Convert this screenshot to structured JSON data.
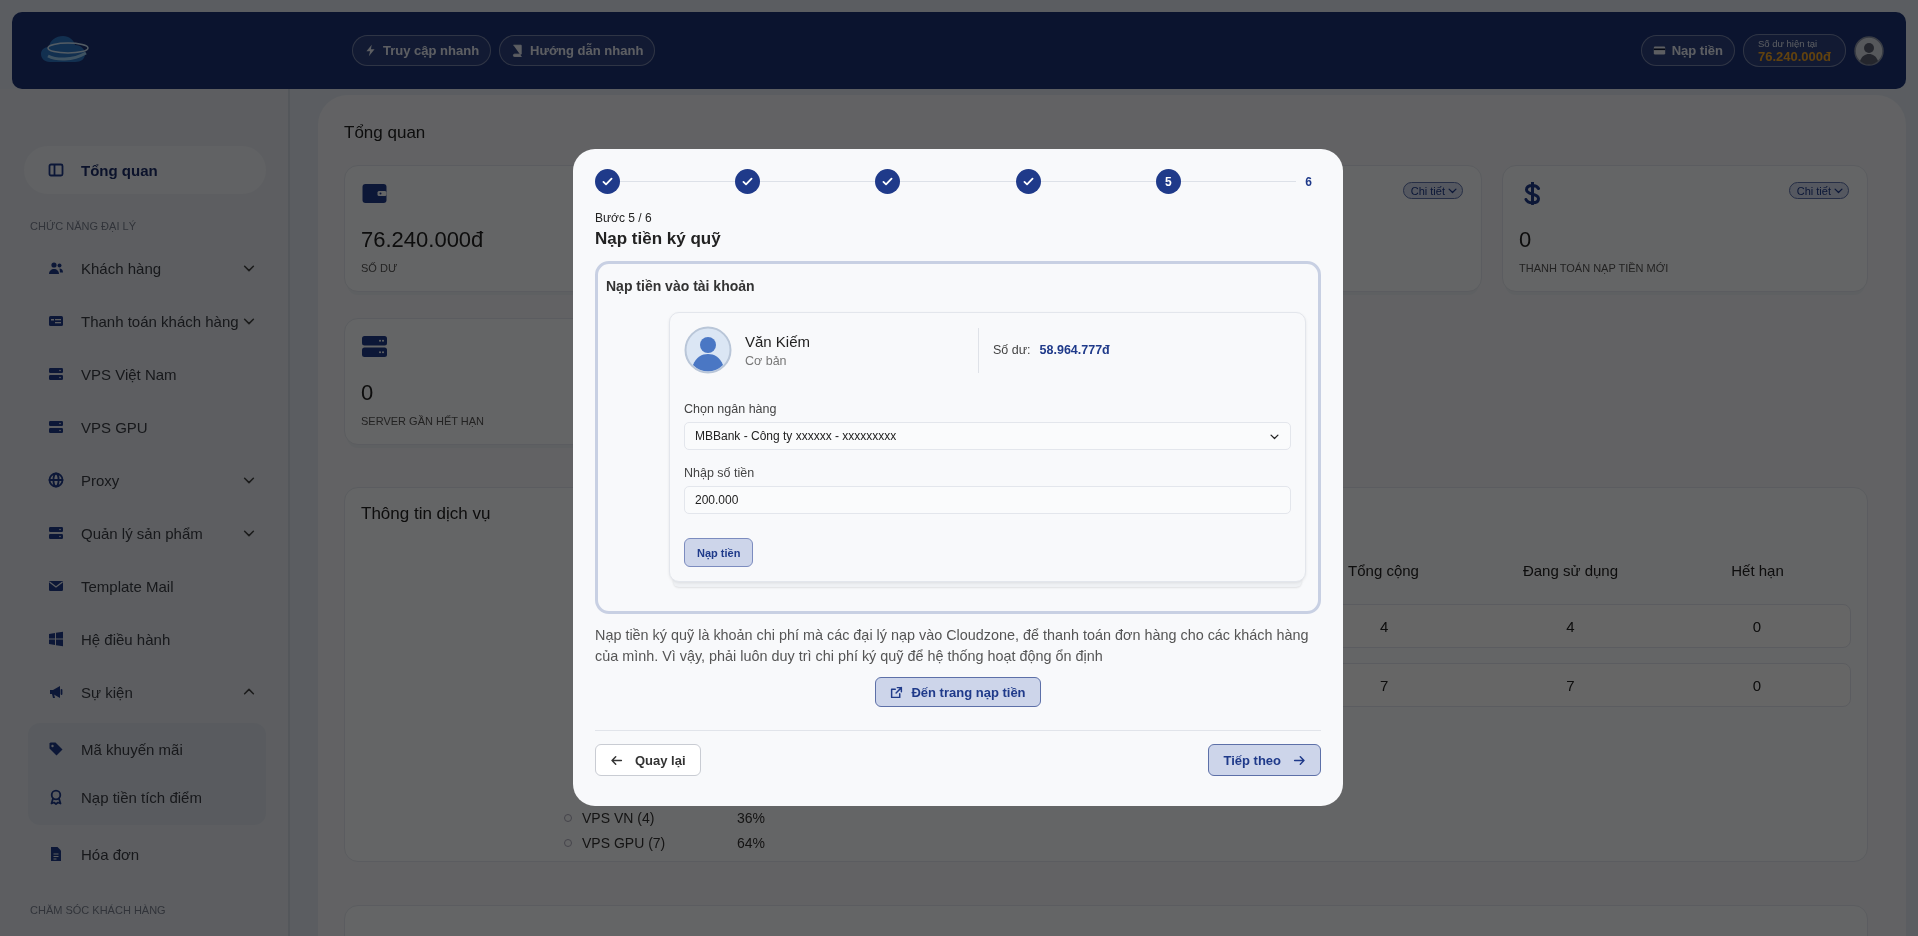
{
  "header": {
    "quick_buttons": [
      "Truy cập nhanh",
      "Hướng dẫn nhanh"
    ],
    "topup_button": "Nạp tiền",
    "balance": {
      "label": "Số dư hiện tại",
      "value": "76.240.000đ"
    }
  },
  "sidebar": {
    "items": [
      {
        "kind": "item",
        "label": "Tổng quan",
        "selected": true
      },
      {
        "kind": "section",
        "label": "CHỨC NĂNG ĐẠI LÝ"
      },
      {
        "kind": "item",
        "label": "Khách hàng",
        "selected": false,
        "expanded": false
      },
      {
        "kind": "item",
        "label": "Thanh toán khách hàng",
        "selected": false,
        "expanded": false
      },
      {
        "kind": "item",
        "label": "VPS Việt Nam",
        "selected": false
      },
      {
        "kind": "item",
        "label": "VPS GPU",
        "selected": false
      },
      {
        "kind": "item",
        "label": "Proxy",
        "selected": false,
        "expanded": false
      },
      {
        "kind": "item",
        "label": "Quản lý sản phẩm",
        "selected": false,
        "expanded": false
      },
      {
        "kind": "item",
        "label": "Template Mail",
        "selected": false
      },
      {
        "kind": "item",
        "label": "Hệ điều hành",
        "selected": false
      },
      {
        "kind": "item",
        "label": "Sự kiện",
        "selected": false,
        "expanded": true,
        "children": [
          {
            "label": "Mã khuyến mãi",
            "selected": false
          },
          {
            "label": "Nạp tiền tích điểm",
            "selected": false
          }
        ]
      },
      {
        "kind": "item",
        "label": "Hóa đơn",
        "selected": false
      },
      {
        "kind": "section",
        "label": "CHĂM SÓC KHÁCH HÀNG"
      }
    ]
  },
  "page_title": "Tổng quan",
  "stat_cards": [
    {
      "value": "76.240.000đ",
      "label": "SỐ DƯ"
    },
    {
      "detail_button": "Chi tiết"
    },
    {
      "detail_button": "Chi tiết",
      "value": "0",
      "label": "THANH TOÁN NẠP TIỀN MỚI"
    },
    {
      "value": "0",
      "label": "SERVER GẦN HẾT HẠN"
    }
  ],
  "service_panel": {
    "title": "Thông tin dịch vụ",
    "legend": [
      {
        "label": "VPS VN (4)",
        "value": "36%"
      },
      {
        "label": "VPS GPU (7)",
        "value": "64%"
      }
    ],
    "table": {
      "columns": [
        "Tổng cộng",
        "Đang sử dụng",
        "Hết hạn"
      ],
      "rows": [
        [
          "4",
          "4",
          "0"
        ],
        [
          "7",
          "7",
          "0"
        ]
      ]
    }
  },
  "modal": {
    "steps": [
      {
        "kind": "done"
      },
      {
        "kind": "done"
      },
      {
        "kind": "done"
      },
      {
        "kind": "done"
      },
      {
        "kind": "current",
        "number": "5"
      },
      {
        "kind": "upcoming",
        "number": "6"
      }
    ],
    "step_caption": "Bước 5 / 6",
    "title": "Nạp tiền ký quỹ",
    "deposit_panel": {
      "title": "Nạp tiền vào tài khoản",
      "account": {
        "name": "Văn Kiếm",
        "tier": "Cơ bản",
        "balance_label": "Số dư:",
        "balance": "58.964.777đ"
      },
      "bank_field": {
        "label": "Chọn ngân hàng",
        "value": "MBBank - Công ty xxxxxx - xxxxxxxxx"
      },
      "amount_field": {
        "label": "Nhập số tiền",
        "value": "200.000"
      },
      "submit_button": "Nạp tiền"
    },
    "description": "Nạp tiền ký quỹ là khoản chi phí mà các đại lý nạp vào Cloudzone, để thanh toán đơn hàng cho các khách hàng của mình. Vì vậy, phải luôn duy trì chi phí ký quỹ để hệ thống hoạt động ổn định",
    "link_button": "Đến trang nạp tiền",
    "back_button": "Quay lại",
    "next_button": "Tiếp theo"
  }
}
